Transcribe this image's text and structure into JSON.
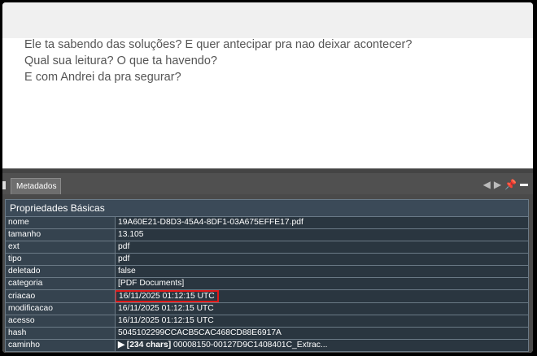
{
  "document": {
    "lines": [
      "Ele ta sabendo das soluções? E quer antecipar pra nao deixar acontecer?",
      "Qual sua leitura? O que ta havendo?",
      "E com Andrei da pra segurar?"
    ]
  },
  "panel": {
    "tab_label": "Metadados",
    "icons": [
      "arrow-left-icon",
      "arrow-right-icon",
      "pin-icon",
      "minimize-icon"
    ]
  },
  "properties": {
    "group_title": "Propriedades Básicas",
    "rows": [
      {
        "key": "nome",
        "value": "19A60E21-D8D3-45A4-8DF1-03A675EFFE17.pdf"
      },
      {
        "key": "tamanho",
        "value": "13.105"
      },
      {
        "key": "ext",
        "value": "pdf"
      },
      {
        "key": "tipo",
        "value": "pdf"
      },
      {
        "key": "deletado",
        "value": "false"
      },
      {
        "key": "categoria",
        "value": "[PDF Documents]"
      },
      {
        "key": "criacao",
        "value": "16/11/2025 01:12:15 UTC",
        "highlighted": true
      },
      {
        "key": "modificacao",
        "value": "16/11/2025 01:12:15 UTC"
      },
      {
        "key": "acesso",
        "value": "16/11/2025 01:12:15 UTC"
      },
      {
        "key": "hash",
        "value": "5045102299CCACB5CAC468CD88E6917A"
      },
      {
        "key": "caminho",
        "value_prefix": "▶ [234 chars]",
        "value": " 00008150-00127D9C1408401C_Extrac..."
      }
    ]
  },
  "colors": {
    "highlight_border": "#e01818",
    "panel_bg": "#4a4a4a",
    "value_cell_bg": "#2a3640",
    "key_cell_bg": "#35434f"
  }
}
